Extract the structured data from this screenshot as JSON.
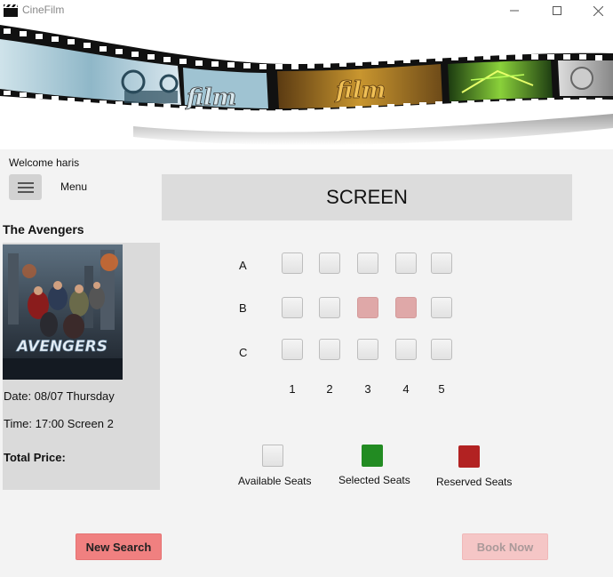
{
  "window": {
    "title": "CineFilm",
    "controls": [
      "minimize-icon",
      "maximize-icon",
      "close-icon"
    ]
  },
  "banner": {
    "text_frames": [
      "film",
      "film"
    ]
  },
  "sidebar": {
    "welcome": "Welcome haris",
    "menu_label": "Menu",
    "menu_icon": "hamburger-icon"
  },
  "movie": {
    "title": "The Avengers",
    "poster_title": "AVENGERS",
    "date": "Date: 08/07 Thursday",
    "time": "Time: 17:00 Screen 2",
    "total_price_label": "Total Price:"
  },
  "screen": {
    "label": "SCREEN"
  },
  "seating": {
    "rows": [
      "A",
      "B",
      "C"
    ],
    "columns": [
      "1",
      "2",
      "3",
      "4",
      "5"
    ],
    "reserved": [
      [
        "B",
        "3"
      ],
      [
        "B",
        "4"
      ]
    ]
  },
  "legend": {
    "available": "Available Seats",
    "selected": "Selected Seats",
    "reserved": "Reserved Seats"
  },
  "colors": {
    "available": "#e8e8e8",
    "selected": "#228b22",
    "reserved": "#b22222",
    "reserved_seat": "#dfa8a8",
    "new_search": "#f08080",
    "book_now_disabled": "#f5c6c6"
  },
  "buttons": {
    "new_search": "New Search",
    "book_now": "Book Now"
  }
}
